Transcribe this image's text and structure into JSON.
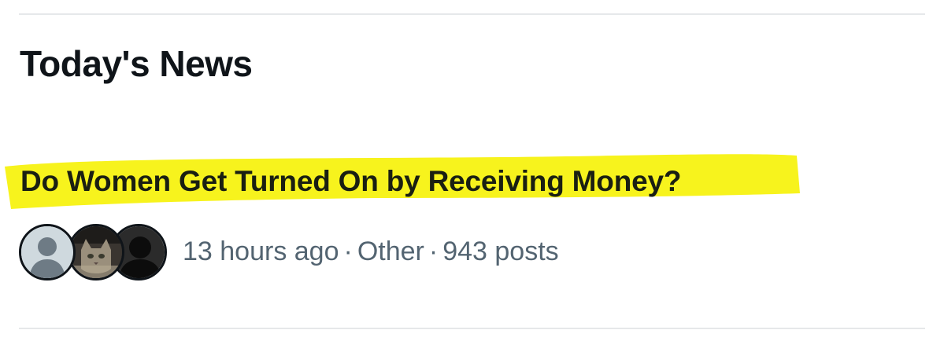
{
  "section": {
    "title": "Today's News"
  },
  "story": {
    "headline": "Do Women Get Turned On by Receiving Money?",
    "highlight_color": "#f7f31d",
    "time": "13 hours ago",
    "separator": "·",
    "category": "Other",
    "posts": "943 posts",
    "avatars": [
      "default-avatar-icon",
      "cat-photo-avatar",
      "dark-silhouette-avatar"
    ]
  },
  "colors": {
    "text_primary": "#0f1419",
    "text_secondary": "#536471",
    "divider": "#e6e8ea"
  }
}
